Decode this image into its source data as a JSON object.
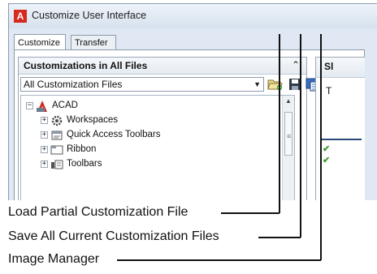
{
  "window": {
    "title": "Customize User Interface"
  },
  "tabs": [
    {
      "label": "Customize"
    },
    {
      "label": "Transfer"
    }
  ],
  "left_pane": {
    "title": "Customizations in All Files",
    "combo_value": "All Customization Files",
    "tree": [
      {
        "label": "ACAD",
        "icon": "acad-icon"
      },
      {
        "label": "Workspaces",
        "icon": "workspaces-gear-icon"
      },
      {
        "label": "Quick Access Toolbars",
        "icon": "quick-access-toolbar-icon"
      },
      {
        "label": "Ribbon",
        "icon": "ribbon-icon"
      },
      {
        "label": "Toolbars",
        "icon": "toolbars-icon"
      }
    ]
  },
  "right_pane": {
    "header_text": "Sl",
    "t_text": "T"
  },
  "callouts": [
    "Load Partial Customization File",
    "Save All Current Customization Files",
    "Image Manager"
  ],
  "colors": {
    "autocad_red": "#d72a1f",
    "check_green": "#3c9a2c"
  }
}
